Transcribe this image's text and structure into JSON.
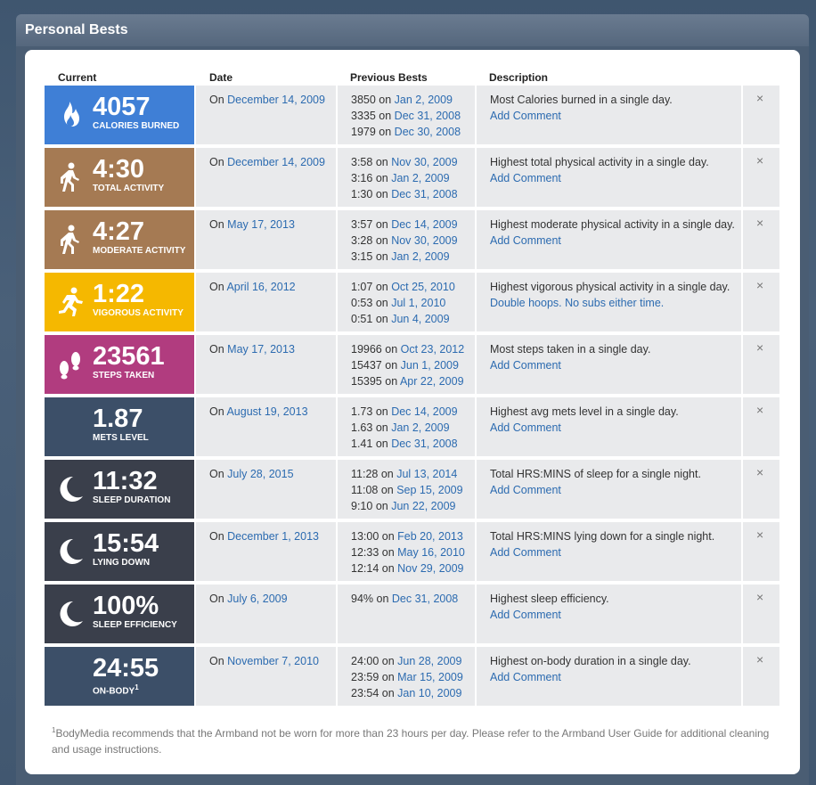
{
  "panel": {
    "title": "Personal Bests"
  },
  "columns": {
    "current": "Current",
    "date": "Date",
    "previous": "Previous Bests",
    "description": "Description"
  },
  "rows": [
    {
      "value": "4057",
      "label": "CALORIES BURNED",
      "color": "#3f7fd6",
      "icon": "flame-icon",
      "date_prefix": "On ",
      "date": "December 14, 2009",
      "prev": [
        {
          "val": "3850",
          "date": "Jan 2, 2009"
        },
        {
          "val": "3335",
          "date": "Dec 31, 2008"
        },
        {
          "val": "1979",
          "date": "Dec 30, 2008"
        }
      ],
      "desc": "Most Calories burned in a single day.",
      "link": "Add Comment"
    },
    {
      "value": "4:30",
      "label": "TOTAL ACTIVITY",
      "color": "#a57a53",
      "icon": "walk-icon",
      "date_prefix": "On ",
      "date": "December 14, 2009",
      "prev": [
        {
          "val": "3:58",
          "date": "Nov 30, 2009"
        },
        {
          "val": "3:16",
          "date": "Jan 2, 2009"
        },
        {
          "val": "1:30",
          "date": "Dec 31, 2008"
        }
      ],
      "desc": "Highest total physical activity in a single day.",
      "link": "Add Comment"
    },
    {
      "value": "4:27",
      "label": "MODERATE ACTIVITY",
      "color": "#a57a53",
      "icon": "walk-icon",
      "date_prefix": "On ",
      "date": "May 17, 2013",
      "prev": [
        {
          "val": "3:57",
          "date": "Dec 14, 2009"
        },
        {
          "val": "3:28",
          "date": "Nov 30, 2009"
        },
        {
          "val": "3:15",
          "date": "Jan 2, 2009"
        }
      ],
      "desc": "Highest moderate physical activity in a single day.",
      "link": "Add Comment"
    },
    {
      "value": "1:22",
      "label": "VIGOROUS ACTIVITY",
      "color": "#f5b800",
      "icon": "run-icon",
      "date_prefix": "On ",
      "date": "April 16, 2012",
      "prev": [
        {
          "val": "1:07",
          "date": "Oct 25, 2010"
        },
        {
          "val": "0:53",
          "date": "Jul 1, 2010"
        },
        {
          "val": "0:51",
          "date": "Jun 4, 2009"
        }
      ],
      "desc": "Highest vigorous physical activity in a single day.",
      "link": "Double hoops. No subs either time."
    },
    {
      "value": "23561",
      "label": "STEPS TAKEN",
      "color": "#b13c7f",
      "icon": "footprints-icon",
      "date_prefix": "On ",
      "date": "May 17, 2013",
      "prev": [
        {
          "val": "19966",
          "date": "Oct 23, 2012"
        },
        {
          "val": "15437",
          "date": "Jun 1, 2009"
        },
        {
          "val": "15395",
          "date": "Apr 22, 2009"
        }
      ],
      "desc": "Most steps taken in a single day.",
      "link": "Add Comment"
    },
    {
      "value": "1.87",
      "label": "METS LEVEL",
      "color": "#3c4f68",
      "icon": "",
      "date_prefix": "On ",
      "date": "August 19, 2013",
      "prev": [
        {
          "val": "1.73",
          "date": "Dec 14, 2009"
        },
        {
          "val": "1.63",
          "date": "Jan 2, 2009"
        },
        {
          "val": "1.41",
          "date": "Dec 31, 2008"
        }
      ],
      "desc": "Highest avg mets level in a single day.",
      "link": "Add Comment"
    },
    {
      "value": "11:32",
      "label": "SLEEP DURATION",
      "color": "#3a3f4b",
      "icon": "moon-icon",
      "date_prefix": "On ",
      "date": "July 28, 2015",
      "prev": [
        {
          "val": "11:28",
          "date": "Jul 13, 2014"
        },
        {
          "val": "11:08",
          "date": "Sep 15, 2009"
        },
        {
          "val": "9:10",
          "date": "Jun 22, 2009"
        }
      ],
      "desc": "Total HRS:MINS of sleep for a single night.",
      "link": "Add Comment"
    },
    {
      "value": "15:54",
      "label": "LYING DOWN",
      "color": "#3a3f4b",
      "icon": "moon-icon",
      "date_prefix": "On ",
      "date": "December 1, 2013",
      "prev": [
        {
          "val": "13:00",
          "date": "Feb 20, 2013"
        },
        {
          "val": "12:33",
          "date": "May 16, 2010"
        },
        {
          "val": "12:14",
          "date": "Nov 29, 2009"
        }
      ],
      "desc": "Total HRS:MINS lying down for a single night.",
      "link": "Add Comment"
    },
    {
      "value": "100%",
      "label": "SLEEP EFFICIENCY",
      "color": "#3a3f4b",
      "icon": "moon-icon",
      "date_prefix": "On ",
      "date": "July 6, 2009",
      "prev": [
        {
          "val": "94%",
          "date": "Dec 31, 2008"
        }
      ],
      "desc": "Highest sleep efficiency.",
      "link": "Add Comment"
    },
    {
      "value": "24:55",
      "label": "ON-BODY",
      "label_sup": "1",
      "color": "#3c4f68",
      "icon": "",
      "date_prefix": "On ",
      "date": "November 7, 2010",
      "prev": [
        {
          "val": "24:00",
          "date": "Jun 28, 2009"
        },
        {
          "val": "23:59",
          "date": "Mar 15, 2009"
        },
        {
          "val": "23:54",
          "date": "Jan 10, 2009"
        }
      ],
      "desc": "Highest on-body duration in a single day.",
      "link": "Add Comment"
    }
  ],
  "close_glyph": "×",
  "on_word": " on ",
  "footnote": {
    "sup": "1",
    "text": "BodyMedia recommends that the Armband not be worn for more than 23 hours per day. Please refer to the Armband User Guide for additional cleaning and usage instructions."
  }
}
